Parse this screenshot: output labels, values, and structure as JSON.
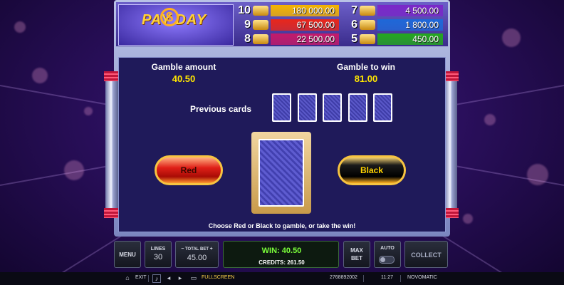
{
  "logo": {
    "text": "PAY DAY",
    "symbol": "$"
  },
  "paytable": {
    "rows": [
      {
        "count": "10",
        "value": "180 000.00",
        "color": "#f4b400"
      },
      {
        "count": "9",
        "value": "67 500.00",
        "color": "#e8261a"
      },
      {
        "count": "8",
        "value": "22 500.00",
        "color": "#c41a6a"
      },
      {
        "count": "7",
        "value": "4 500.00",
        "color": "#7a28c8"
      },
      {
        "count": "6",
        "value": "1 800.00",
        "color": "#1e68d8"
      },
      {
        "count": "5",
        "value": "450.00",
        "color": "#24a81e"
      }
    ]
  },
  "gamble": {
    "amount_label": "Gamble amount",
    "amount_value": "40.50",
    "to_win_label": "Gamble to win",
    "to_win_value": "81.00",
    "previous_cards_label": "Previous cards",
    "previous_cards_count": 5,
    "red_label": "Red",
    "black_label": "Black",
    "hint": "Choose Red or Black to gamble, or take the win!"
  },
  "console": {
    "menu_label": "MENU",
    "lines_label": "LINES",
    "lines_value": "30",
    "total_bet_label": "TOTAL BET",
    "total_bet_value": "45.00",
    "win_text": "WIN: 40.50",
    "credits_text": "CREDITS: 261.50",
    "max_bet_line1": "MAX",
    "max_bet_line2": "BET",
    "auto_label": "AUTO",
    "collect_label": "COLLECT"
  },
  "footer": {
    "exit_label": "EXIT",
    "fullscreen_label": "FULLSCREEN",
    "session_id": "2768892002",
    "clock": "11:27",
    "brand": "NOVOMATIC",
    "icons": [
      "home-icon",
      "sound-icon",
      "volume-down-icon",
      "volume-up-icon",
      "fullscreen-icon"
    ]
  },
  "colors": {
    "value_yellow": "#ffe600",
    "win_green": "#7aff3a",
    "panel_bg": "#1f1a5a"
  }
}
